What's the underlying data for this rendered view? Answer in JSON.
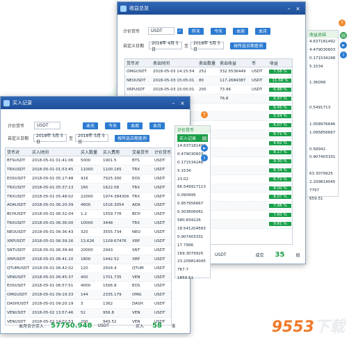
{
  "w2": {
    "title": "收益总览",
    "label_metric": "计价货币",
    "currency": "USDT",
    "btns": [
      "昨天",
      "今天",
      "本周",
      "本月"
    ],
    "label_date": "自定义日期",
    "date_from": "2018年 4月 5日",
    "to": "至",
    "date_to": "2018年 5月 5日",
    "btn_query": "按所选日期查询",
    "headers": [
      "货币对",
      "卖出时间",
      "卖出数量",
      "卖出收益",
      "币",
      "收益"
    ],
    "rows": [
      [
        "OMGUSDT",
        "2018-05-03 14:15:54",
        "252",
        "332.5536449",
        "USDT",
        "7.58 %"
      ],
      [
        "NEOUSDT",
        "2018-05-03 15:05:01",
        "80",
        "117.2684387",
        "USDT",
        "11.68 %"
      ],
      [
        "XRPUSDT",
        "2018-05-03 15:05:01",
        "200",
        "73.96",
        "USDT",
        "6.88 %"
      ],
      [
        "",
        "",
        "",
        "76.8",
        "",
        "6.97 %"
      ],
      [
        "",
        "",
        "",
        "",
        "",
        "6.45 %"
      ],
      [
        "",
        "",
        "",
        "",
        "",
        "5.54 %"
      ],
      [
        "",
        "",
        "",
        "",
        "",
        "6.07 %"
      ],
      [
        "",
        "",
        "",
        "",
        "",
        "6.71 %"
      ],
      [
        "",
        "",
        "",
        "",
        "",
        "4.82 %"
      ],
      [
        "",
        "",
        "",
        "",
        "",
        "8.17 %"
      ],
      [
        "",
        "",
        "",
        "",
        "",
        "9.30 %"
      ],
      [
        "",
        "",
        "",
        "",
        "",
        "8.34 %"
      ],
      [
        "",
        "",
        "",
        "",
        "",
        "6.72 %"
      ],
      [
        "",
        "",
        "",
        "",
        "",
        "8.00 %"
      ],
      [
        "",
        "",
        "",
        "",
        "",
        "8.07 %"
      ],
      [
        "",
        "",
        "",
        "",
        "",
        "7.98 %"
      ],
      [
        "",
        "",
        "",
        "",
        "",
        "7.60 %"
      ],
      [
        "",
        "",
        "",
        "",
        "",
        "9.81 %"
      ]
    ],
    "foot_left": "USDT",
    "foot_mid": "成交",
    "foot_count": "35",
    "foot_unit": "组",
    "side_panel": {
      "head": "收益总结",
      "values": [
        "4.637181492",
        "4.479030603",
        "0.171534248",
        "5.1534",
        "",
        "1.36098",
        "",
        "",
        "0.5491713",
        "",
        "1.058976646",
        "1.095856667",
        "",
        "0.58942",
        "0.907403331",
        "",
        "63.3079925",
        "2.209814045",
        "7767",
        "659.51"
      ]
    }
  },
  "w1": {
    "title": "买入记录",
    "label_metric": "计价货币",
    "currency": "USDT",
    "btns": [
      "本天",
      "今天",
      "本周",
      "本月"
    ],
    "label_date": "自定义日期",
    "date_from": "2018年 5月 5日",
    "to": "至",
    "date_to": "2018年 5月 5日",
    "btn_query": "按所选日期查询",
    "headers": [
      "货币对",
      "买入时间",
      "买入数量",
      "买入费用",
      "交易货币",
      "计价货币"
    ],
    "rows": [
      [
        "BTSUSDT",
        "2018-05-01 01:41:06",
        "5000",
        "1901.5",
        "BTS",
        "USDT"
      ],
      [
        "TRXUSDT",
        "2018-05-01 01:53:45",
        "11000",
        "1100.165",
        "TRX",
        "USDT"
      ],
      [
        "EOSUSDT",
        "2018-05-01 05:17:48",
        "416",
        "7925.300",
        "EOS",
        "USDT"
      ],
      [
        "TRXUSDT",
        "2018-05-01 05:37:13",
        "160",
        "1622.08",
        "TRX",
        "USDT"
      ],
      [
        "TRXUSDT",
        "2018-05-01 05:48:02",
        "22000",
        "1974.384309",
        "TRX",
        "USDT"
      ],
      [
        "ADAUSDT",
        "2018-05-01 06:20:39",
        "4600",
        "1516.3054",
        "ADA",
        "USDT"
      ],
      [
        "BCHUSDT",
        "2018-05-01 06:32:04",
        "1.2",
        "1559.776",
        "BCH",
        "USDT"
      ],
      [
        "TRXUSDT",
        "2018-05-01 06:36:00",
        "10000",
        "3448",
        "TRX",
        "USDT"
      ],
      [
        "NEOUSDT",
        "2018-05-01 06:36:43",
        "320",
        "3555.734",
        "NEO",
        "USDT"
      ],
      [
        "XRPUSDT",
        "2018-05-01 06:39:16",
        "13,626",
        "1109.67476",
        "XRP",
        "USDT"
      ],
      [
        "SNTUSDT",
        "2018-05-01 06:39:40",
        "20000",
        "2943",
        "SNT",
        "USDT"
      ],
      [
        "XRPUSDT",
        "2018-05-01 06:41:10",
        "1800",
        "1442.52",
        "XRP",
        "USDT"
      ],
      [
        "QTUMUSDT",
        "2018-05-01 06:42:02",
        "120",
        "2504.4",
        "QTUM",
        "USDT"
      ],
      [
        "VENUSDT",
        "2018-05-01 06:45:37",
        "400",
        "1701.735",
        "VEN",
        "USDT"
      ],
      [
        "EOSUSDT",
        "2018-05-01 06:57:51",
        "4000",
        "1566.8",
        "EOS",
        "USDT"
      ],
      [
        "OMGUSDT",
        "2018-05-01 09:19:33",
        "144",
        "2335.179",
        "OMG",
        "USDT"
      ],
      [
        "DASHUSDT",
        "2018-05-01 09:20:19",
        "3",
        "1362",
        "DASH",
        "USDT"
      ],
      [
        "VENUSDT",
        "2018-05-02 13:57:46",
        "52",
        "956.8",
        "VEN",
        "USDT"
      ],
      [
        "VENUSDT",
        "2018-05-02 14:02:53",
        "200",
        "949.52",
        "VEN",
        "USDT"
      ]
    ],
    "foot_label": "本月合计买入",
    "foot_total": "57750.948",
    "foot_cur": "USDT",
    "foot_buy": "买入",
    "foot_count": "58",
    "foot_unit": "条",
    "side_panel": {
      "head": "计价货币",
      "btn": "买入记录",
      "values": [
        "14.637181492",
        "0.479030603",
        "0.171534248",
        "5.1534",
        "23.02",
        "66.549917113",
        "0.090995",
        "0.957956667",
        "0.303606061",
        "580.834226",
        "18.541204583",
        "0.907403331",
        "17.7996",
        "169.3079925",
        "23.209814045",
        "767.7",
        "1859.51"
      ]
    }
  },
  "watermark": {
    "num": "9553",
    "txt": "下载"
  }
}
